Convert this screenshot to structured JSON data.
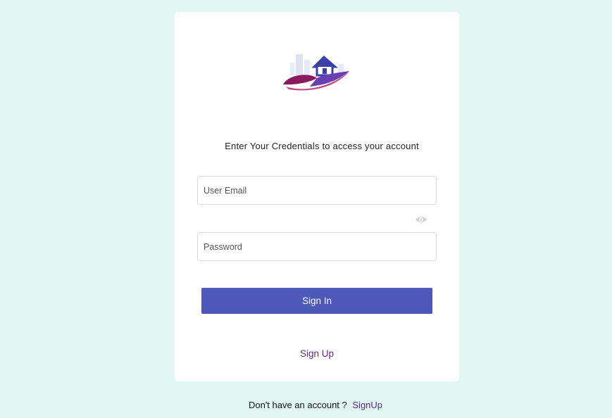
{
  "logo": {
    "icon": "house-hands-logo-icon"
  },
  "subtitle": "Enter Your Credentials to access your account",
  "form": {
    "email_placeholder": "User Email",
    "password_placeholder": "Password",
    "show_password_icon": "eye-icon",
    "signin_label": "Sign In",
    "signup_link": "Sign Up"
  },
  "footer": {
    "prompt": "Don't have an account ?",
    "signup_link": "SignUp"
  },
  "colors": {
    "background": "#e0f7f4",
    "primary_button": "#4d59b8",
    "link": "#5b2a86"
  }
}
